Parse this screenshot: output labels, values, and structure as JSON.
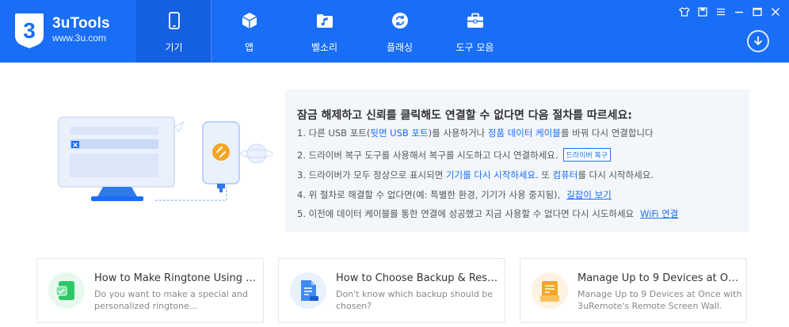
{
  "brand": {
    "name": "3uTools",
    "url": "www.3u.com"
  },
  "nav": [
    {
      "label": "기기",
      "icon": "phone-icon",
      "active": true
    },
    {
      "label": "앱",
      "icon": "apps-cube-icon",
      "active": false
    },
    {
      "label": "벨소리",
      "icon": "ringtone-folder-icon",
      "active": false
    },
    {
      "label": "플래싱",
      "icon": "flash-refresh-icon",
      "active": false
    },
    {
      "label": "도구 모음",
      "icon": "toolbox-icon",
      "active": false
    }
  ],
  "window_controls": [
    "shirt-skin-icon",
    "save-icon",
    "menu-icon",
    "minimize-icon",
    "maximize-icon",
    "close-icon"
  ],
  "help": {
    "title": "잠금 해제하고 신뢰를 클릭해도 연결할 수 없다면 다음 절차를 따르세요:",
    "step1": {
      "a": "1. 다른 USB 포트(",
      "b": "뒷면 USB 포트",
      "c": ")를 사용하거나 ",
      "d": "정품 데이터 케이블",
      "e": "를 바꿔 다시 연결합니다"
    },
    "step2": {
      "text": "2. 드라이버 복구 도구를 사용해서 복구를 시도하고 다시 연결하세요.",
      "button": "드라이버 복구"
    },
    "step3": {
      "a": "3. 드라이버가 모두 정상으로 표시되면 ",
      "b": "기기를 다시 시작하세요",
      "c": ". 또 ",
      "d": "컴퓨터",
      "e": "를 다시 시작하세요."
    },
    "step4": {
      "text": "4. 위 절차로 해결할 수 없다면(예: 특별한 환경, 기기가 사용 중지됨),",
      "link": "길잡이 보기"
    },
    "step5": {
      "text": "5. 이전에 데이터 케이블를 통한 연결에 성공했고 지금 사용할 수 없다면 다시 시도하세요",
      "link": "WiFi 연결"
    }
  },
  "cards": [
    {
      "title": "How to Make Ringtone Using 3...",
      "desc": "Do you want to make a special and personalized ringtone...",
      "icon": "ringtone-card-icon",
      "color": "#2ec866"
    },
    {
      "title": "How to Choose Backup & Resto...",
      "desc": "Don't know which backup should be chosen?",
      "icon": "backup-card-icon",
      "color": "#3d8bf0"
    },
    {
      "title": "Manage Up to 9 Devices at Onc...",
      "desc": "Manage Up to 9 Devices at Once with 3uRemote's Remote Screen Wall.",
      "icon": "remote-card-icon",
      "color": "#f5a623"
    }
  ]
}
